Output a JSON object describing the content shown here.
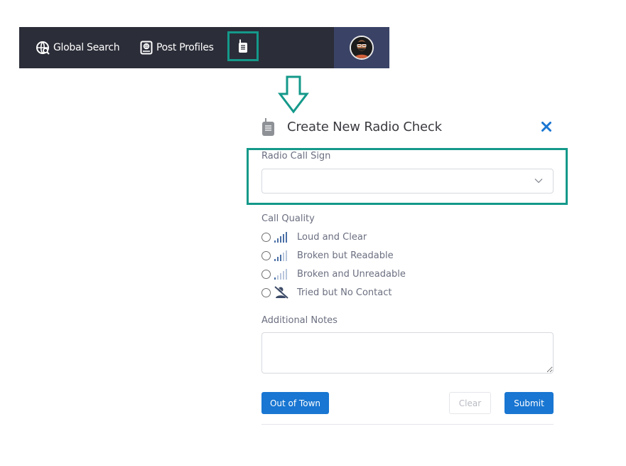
{
  "nav": {
    "global_search": "Global Search",
    "post_profiles": "Post Profiles"
  },
  "modal": {
    "title": "Create New Radio Check",
    "call_sign_label": "Radio Call Sign",
    "call_sign_value": "",
    "call_quality_label": "Call Quality",
    "call_quality_options": [
      {
        "label": "Loud and Clear",
        "icon": "signal-full-icon"
      },
      {
        "label": "Broken but Readable",
        "icon": "signal-medium-icon"
      },
      {
        "label": "Broken and Unreadable",
        "icon": "signal-low-icon"
      },
      {
        "label": "Tried but No Contact",
        "icon": "no-contact-icon"
      }
    ],
    "notes_label": "Additional Notes",
    "notes_value": "",
    "out_of_town_label": "Out of Town",
    "clear_label": "Clear",
    "submit_label": "Submit"
  },
  "colors": {
    "nav_bg": "#2b2d38",
    "avatar_panel_bg": "#3a4366",
    "highlight": "#14998a",
    "primary_button": "#1976d2",
    "close_icon": "#1976d2"
  }
}
